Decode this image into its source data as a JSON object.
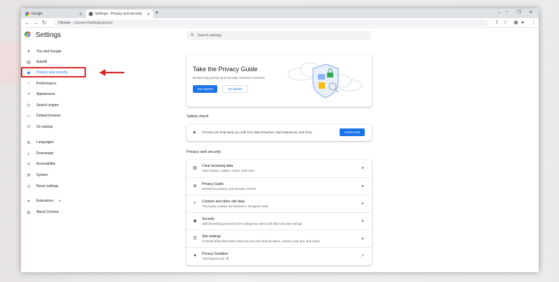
{
  "tabs": [
    {
      "label": "Google",
      "active": false
    },
    {
      "label": "Settings - Privacy and security",
      "active": true
    }
  ],
  "toolbar": {
    "back": "←",
    "forward": "→",
    "reload": "↻",
    "chip": "Chrome",
    "url": "chrome://settings/privacy"
  },
  "window_controls": {
    "min": "–",
    "max": "❐",
    "close": "✕",
    "chevron": "⌄"
  },
  "settings": {
    "title": "Settings"
  },
  "search": {
    "placeholder": "Search settings"
  },
  "sidebar": {
    "items": [
      {
        "label": "You and Google",
        "icon": "person-icon"
      },
      {
        "label": "Autofill",
        "icon": "autofill-icon"
      },
      {
        "label": "Privacy and security",
        "icon": "shield-icon",
        "active": true
      },
      {
        "label": "Performance",
        "icon": "performance-icon"
      },
      {
        "label": "Appearance",
        "icon": "palette-icon"
      },
      {
        "label": "Search engine",
        "icon": "search-icon"
      },
      {
        "label": "Default browser",
        "icon": "browser-icon"
      },
      {
        "label": "On startup",
        "icon": "power-icon"
      },
      {
        "label": "Languages",
        "icon": "globe-icon"
      },
      {
        "label": "Downloads",
        "icon": "download-icon"
      },
      {
        "label": "Accessibility",
        "icon": "accessibility-icon"
      },
      {
        "label": "System",
        "icon": "wrench-icon"
      },
      {
        "label": "Reset settings",
        "icon": "reset-icon"
      },
      {
        "label": "Extensions",
        "icon": "puzzle-icon"
      },
      {
        "label": "About Chrome",
        "icon": "chrome-icon"
      }
    ]
  },
  "privacy_guide": {
    "title": "Take the Privacy Guide",
    "description": "Review key privacy and security controls in Chrome",
    "primary_button": "Get started",
    "secondary_button": "No thanks"
  },
  "safety_check": {
    "heading": "Safety check",
    "text": "Chrome can help keep you safe from data breaches, bad extensions, and more",
    "button": "Check now"
  },
  "privacy_security": {
    "heading": "Privacy and security",
    "rows": [
      {
        "title": "Clear browsing data",
        "subtitle": "Clear history, cookies, cache, and more",
        "icon": "trash-icon"
      },
      {
        "title": "Privacy Guide",
        "subtitle": "Review key privacy and security controls",
        "icon": "privacy-guide-icon"
      },
      {
        "title": "Cookies and other site data",
        "subtitle": "Third-party cookies are blocked in Incognito mode",
        "icon": "cookie-icon"
      },
      {
        "title": "Security",
        "subtitle": "Safe Browsing (protection from dangerous sites) and other security settings",
        "icon": "security-icon"
      },
      {
        "title": "Site settings",
        "subtitle": "Controls what information sites can use and show (location, camera, pop-ups, and more)",
        "icon": "sliders-icon"
      },
      {
        "title": "Privacy Sandbox",
        "subtitle": "Trial features are off",
        "icon": "sandbox-icon"
      }
    ]
  },
  "colors": {
    "accent": "#1a73e8",
    "annotation": "#d92626"
  }
}
